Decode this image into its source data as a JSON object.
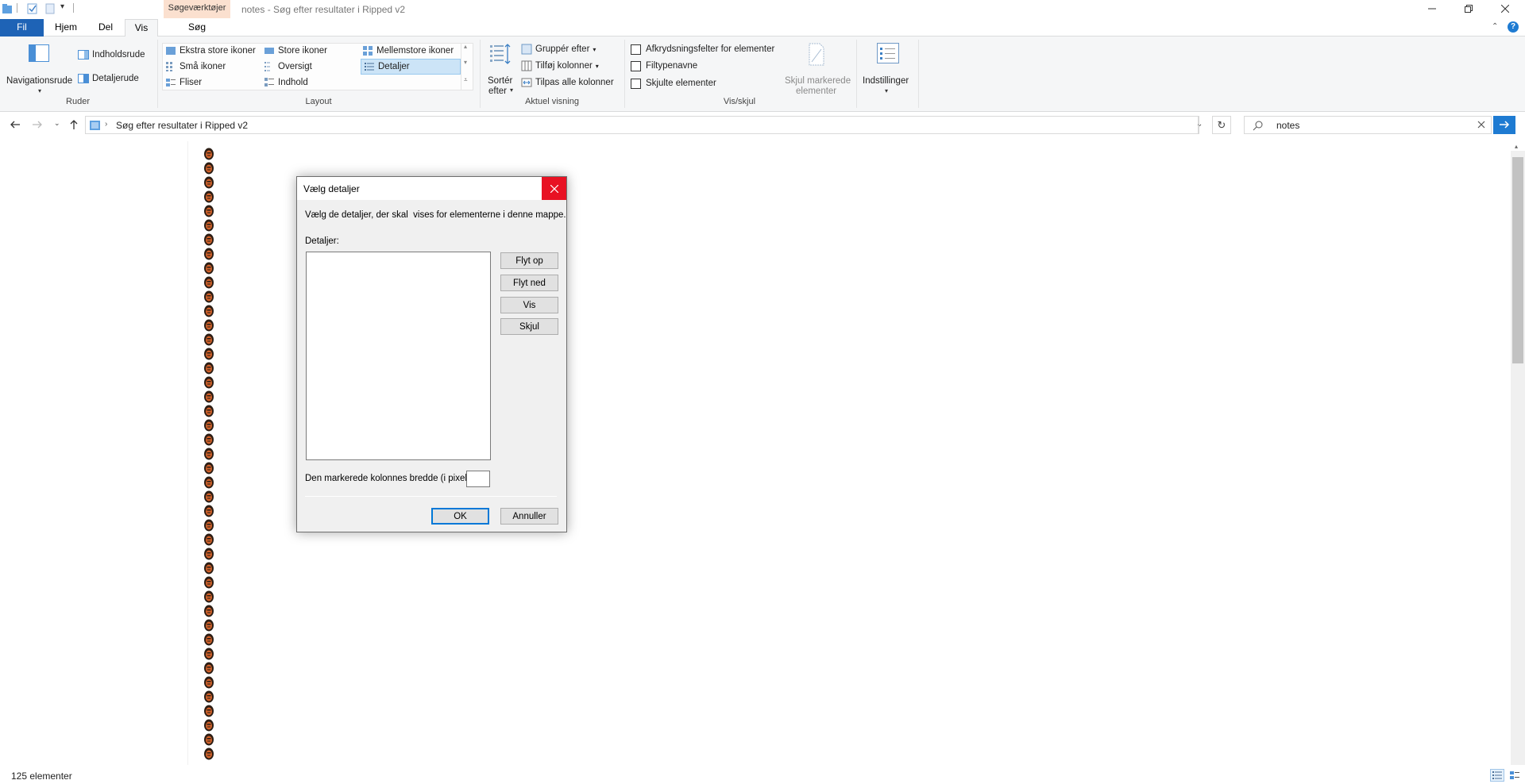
{
  "titlebar": {
    "context_tab": "Søgeværktøjer",
    "title": "notes - Søg efter resultater i Ripped v2"
  },
  "tabs": {
    "fil": "Fil",
    "hjem": "Hjem",
    "del": "Del",
    "vis": "Vis",
    "sog": "Søg"
  },
  "ribbon": {
    "ruder": {
      "label": "Ruder",
      "navigationsrude": "Navigationsrude",
      "indholdsrude": "Indholdsrude",
      "detaljerude": "Detaljerude"
    },
    "layout": {
      "label": "Layout",
      "items": [
        "Ekstra store ikoner",
        "Store ikoner",
        "Mellemstore ikoner",
        "Små ikoner",
        "Oversigt",
        "Detaljer",
        "Fliser",
        "Indhold"
      ],
      "selected": "Detaljer"
    },
    "aktuel_visning": {
      "label": "Aktuel visning",
      "sort_line1": "Sortér",
      "sort_line2": "efter",
      "group_by": "Gruppér efter",
      "add_columns": "Tilføj kolonner",
      "fit_columns": "Tilpas alle kolonner"
    },
    "vis_skjul": {
      "label": "Vis/skjul",
      "checkbox_items": "Afkrydsningsfelter for elementer",
      "file_ext": "Filtypenavne",
      "hidden_items": "Skjulte elementer",
      "hide_selected_line1": "Skjul markerede",
      "hide_selected_line2": "elementer"
    },
    "options": "Indstillinger"
  },
  "address": {
    "path": "Søg efter resultater i Ripped v2",
    "search_value": "notes"
  },
  "status": {
    "count": "125 elementer"
  },
  "dialog": {
    "title": "Vælg detaljer",
    "description": "Vælg de detaljer, der skal  vises for elementerne i denne mappe.",
    "details_label": "Detaljer:",
    "move_up": "Flyt op",
    "move_down": "Flyt ned",
    "show": "Vis",
    "hide": "Skjul",
    "width_label": "Den markerede kolonnes bredde (i pixel):",
    "width_value": "",
    "ok": "OK",
    "cancel": "Annuller"
  },
  "file_icon_count": 43,
  "colors": {
    "accent": "#1e63b6",
    "context_tab": "#fbe0cf",
    "close_red": "#e81123",
    "search_go": "#1e7bd2"
  }
}
